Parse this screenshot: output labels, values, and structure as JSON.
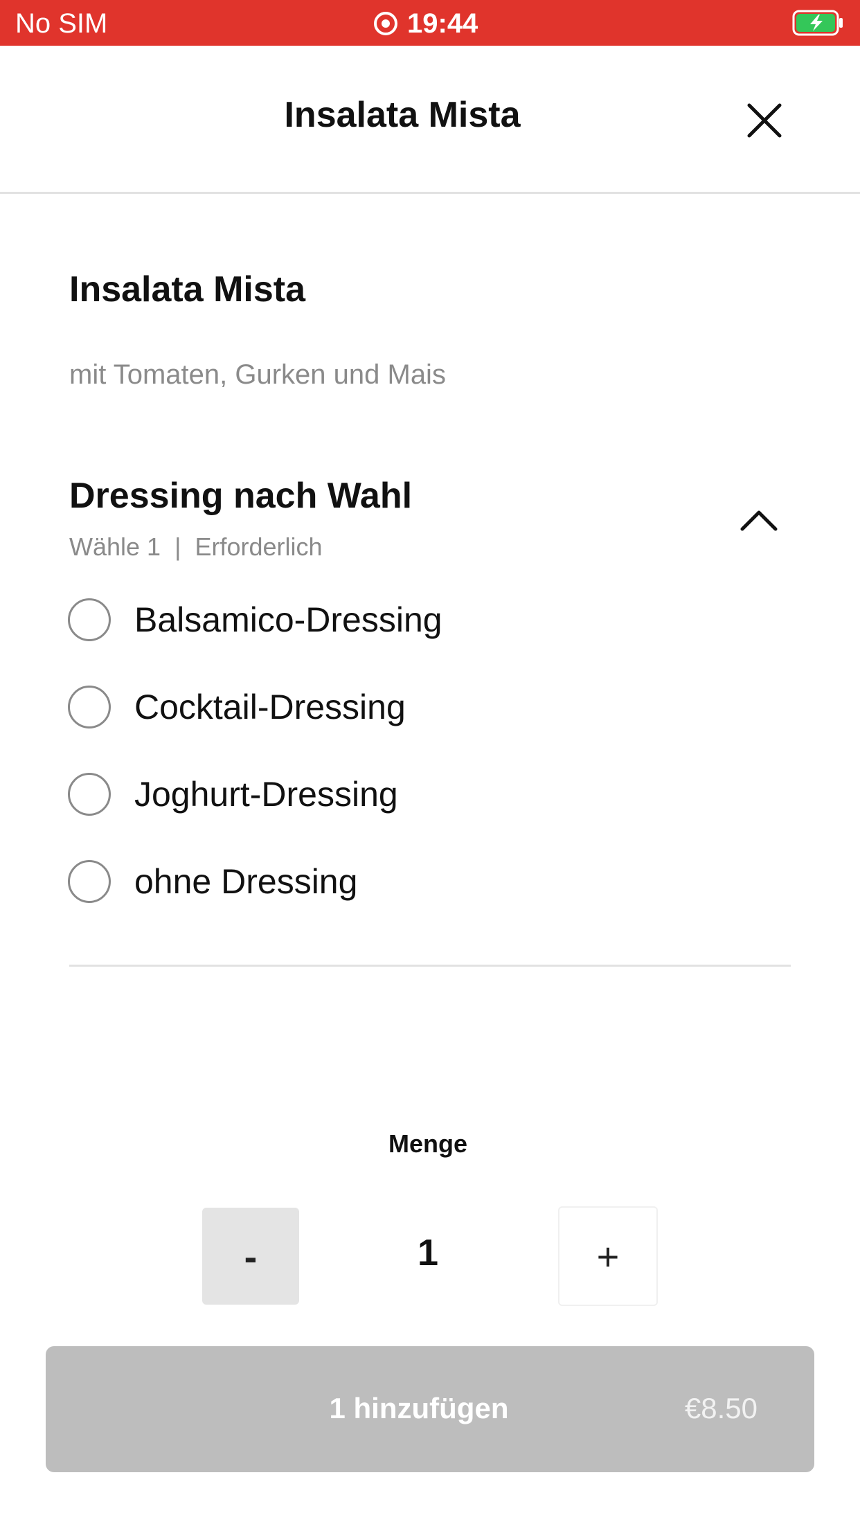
{
  "status_bar": {
    "carrier": "No SIM",
    "time": "19:44",
    "battery_state": "charging",
    "background_color": "#e0342c",
    "battery_color": "#34c759"
  },
  "header": {
    "title": "Insalata Mista",
    "close_icon": "close-icon"
  },
  "item": {
    "name": "Insalata Mista",
    "description": "mit Tomaten, Gurken und Mais"
  },
  "option_group": {
    "title": "Dressing nach Wahl",
    "choose_text": "Wähle 1",
    "separator": "|",
    "required_text": "Erforderlich",
    "collapse_icon": "chevron-up-icon",
    "options": [
      {
        "label": "Balsamico-Dressing",
        "selected": false
      },
      {
        "label": "Cocktail-Dressing",
        "selected": false
      },
      {
        "label": "Joghurt-Dressing",
        "selected": false
      },
      {
        "label": "ohne Dressing",
        "selected": false
      }
    ]
  },
  "quantity": {
    "label": "Menge",
    "minus_label": "-",
    "value": "1",
    "plus_label": "+"
  },
  "add_button": {
    "label": "1 hinzufügen",
    "price": "€8.50",
    "background_color": "#bdbdbd"
  }
}
